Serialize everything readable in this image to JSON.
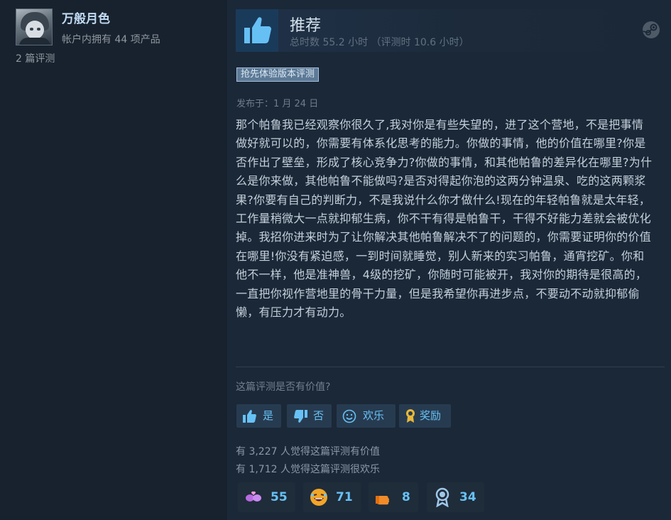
{
  "reviewer": {
    "name": "万般月色",
    "products_owned": "帐户内拥有 44 项产品",
    "review_count": "2 篇评测"
  },
  "review": {
    "recommendation": "推荐",
    "playtime": "总时数 55.2 小时 （评测时 10.6 小时）",
    "early_access_badge": "抢先体验版本评测",
    "posted_date": "发布于：1 月 24 日",
    "body": "那个帕鲁我已经观察你很久了,我对你是有些失望的，进了这个营地，不是把事情做好就可以的，你需要有体系化思考的能力。你做的事情，他的价值在哪里?你是否作出了壁垒，形成了核心竞争力?你做的事情，和其他帕鲁的差异化在哪里?为什么是你来做，其他帕鲁不能做吗?是否对得起你泡的这两分钟温泉、吃的这两颗浆果?你要有自己的判断力，不是我说什么你才做什么!现在的年轻帕鲁就是太年轻，工作量稍微大一点就抑郁生病，你不干有得是帕鲁干，干得不好能力差就会被优化掉。我招你进来时为了让你解决其他帕鲁解决不了的问题的，你需要证明你的价值在哪里!你没有紧迫感，一到时间就睡觉，别人新来的实习帕鲁，通宵挖矿。你和他不一样，他是准神兽，4级的挖矿，你随时可能被开，我对你的期待是很高的，一直把你视作营地里的骨干力量，但是我希望你再进步点，不要动不动就抑郁偷懒，有压力才有动力。"
  },
  "feedback": {
    "question": "这篇评测是否有价值?",
    "buttons": {
      "yes": "是",
      "no": "否",
      "funny": "欢乐",
      "award": "奖励"
    },
    "helpful_count": "有 3,227 人觉得这篇评测有价值",
    "funny_count": "有 1,712 人觉得这篇评测很欢乐"
  },
  "awards": [
    {
      "icon": "heart-hands-icon",
      "count": "55"
    },
    {
      "icon": "laughing-face-icon",
      "count": "71"
    },
    {
      "icon": "hand-point-icon",
      "count": "8"
    },
    {
      "icon": "medal-icon",
      "count": "34"
    }
  ],
  "colors": {
    "background": "#1b2838",
    "accent": "#67c1f5",
    "badge": "#5d7a97"
  }
}
